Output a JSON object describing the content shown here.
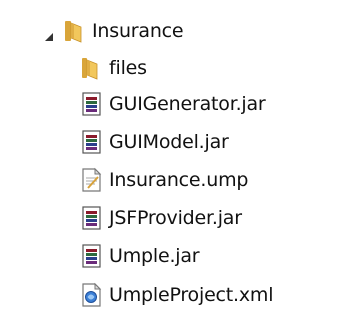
{
  "tree": {
    "root": {
      "label": "Insurance",
      "icon": "folder-open-icon",
      "expanded": true
    },
    "children": [
      {
        "label": "files",
        "icon": "folder-icon"
      },
      {
        "label": "GUIGenerator.jar",
        "icon": "jar-archive-icon"
      },
      {
        "label": "GUIModel.jar",
        "icon": "jar-archive-icon"
      },
      {
        "label": "Insurance.ump",
        "icon": "text-file-icon"
      },
      {
        "label": "JSFProvider.jar",
        "icon": "jar-archive-icon"
      },
      {
        "label": "Umple.jar",
        "icon": "jar-archive-icon"
      },
      {
        "label": "UmpleProject.xml",
        "icon": "xml-file-icon"
      }
    ]
  },
  "colors": {
    "folder": "#e8b74a",
    "folder_light": "#f6d98a",
    "expander": "#333333",
    "text": "#111111"
  }
}
